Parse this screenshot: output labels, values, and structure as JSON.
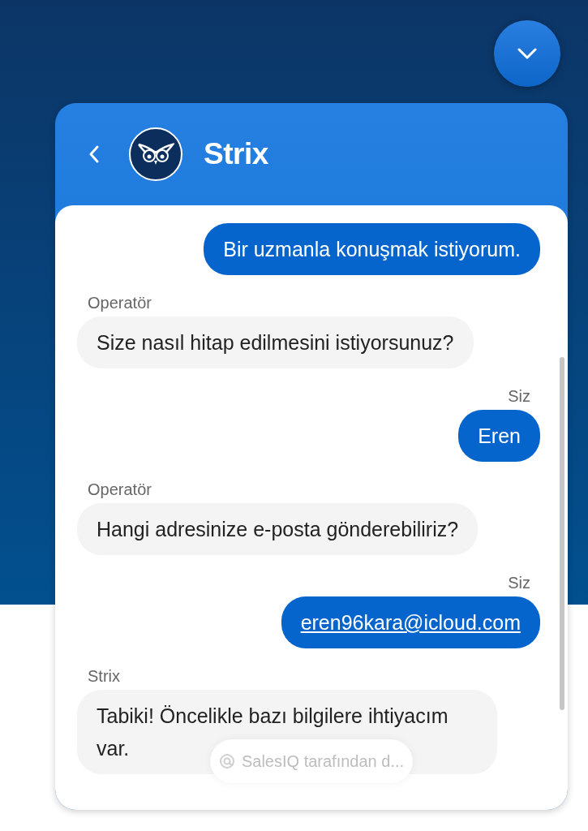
{
  "header": {
    "title": "Strix"
  },
  "messages": [
    {
      "kind": "user",
      "text": "Bir uzmanla konuşmak istiyorum.",
      "link": false
    },
    {
      "kind": "agent",
      "sender": "Operatör",
      "text": "Size nasıl hitap edilmesini istiyorsunuz?",
      "link": false
    },
    {
      "kind": "user",
      "sender": "Siz",
      "text": "Eren",
      "link": false
    },
    {
      "kind": "agent",
      "sender": "Operatör",
      "text": "Hangi adresinize e-posta gönderebiliriz?",
      "link": false
    },
    {
      "kind": "user",
      "sender": "Siz",
      "text": "eren96kara@icloud.com",
      "link": true
    },
    {
      "kind": "agent",
      "sender": "Strix",
      "text": "Tabiki! Öncelikle bazı bilgilere ihtiyacım var.",
      "link": false
    }
  ],
  "powered_by": "SalesIQ tarafından d..."
}
